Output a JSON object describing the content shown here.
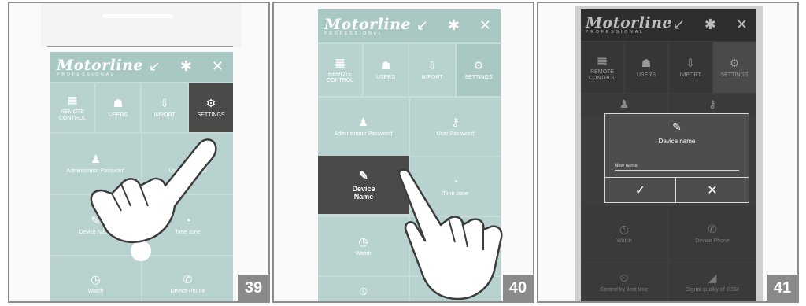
{
  "app": {
    "logo": "Motorline",
    "logo_sub": "PROFESSIONAL",
    "top_icons": "↙ ✱ ✕"
  },
  "tabs": {
    "remote_control": "REMOTE CONTROL",
    "users": "USERS",
    "import": "IMPORT",
    "settings": "SETTINGS"
  },
  "settings_items": {
    "admin_password": "Administrator Password",
    "user_password": "User Password",
    "device_name": "Device Name",
    "time_zone": "Time zone",
    "watch": "Watch",
    "device_phone": "Device Phone",
    "control_by_time": "Control by limit time",
    "signal_quality": "Signal quality of GSM"
  },
  "dialog": {
    "title": "Device name",
    "placeholder": "New name",
    "confirm": "✓",
    "cancel": "✕"
  },
  "steps": [
    "39",
    "40",
    "41"
  ],
  "colors": {
    "teal": "#b8d3cf",
    "dark_tile": "#4a4a48",
    "step_badge": "#8a8a8a"
  },
  "icons": [
    "remote-control-icon",
    "users-icon",
    "import-icon",
    "settings-gear-icon",
    "person-icon",
    "key-icon",
    "pencil-icon",
    "clock-icon",
    "phone-icon",
    "timer-icon",
    "signal-icon",
    "pointing-hand-icon"
  ]
}
